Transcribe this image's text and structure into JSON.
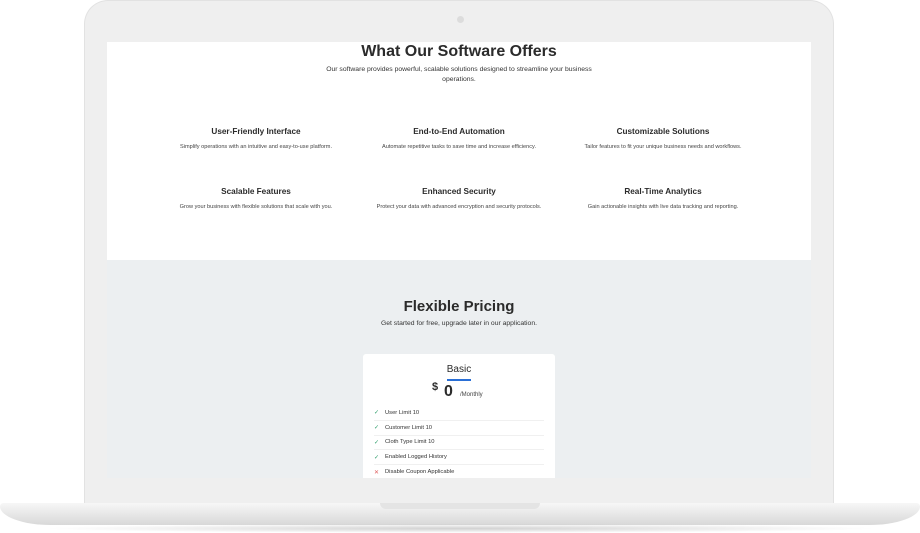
{
  "offers": {
    "title": "What Our Software Offers",
    "subtitle": "Our software provides powerful, scalable solutions designed to streamline your business operations.",
    "features": [
      {
        "title": "User-Friendly Interface",
        "desc": "Simplify operations with an intuitive and easy-to-use platform."
      },
      {
        "title": "End-to-End Automation",
        "desc": "Automate repetitive tasks to save time and increase efficiency."
      },
      {
        "title": "Customizable Solutions",
        "desc": "Tailor features to fit your unique business needs and workflows."
      },
      {
        "title": "Scalable Features",
        "desc": "Grow your business with flexible solutions that scale with you."
      },
      {
        "title": "Enhanced Security",
        "desc": "Protect your data with advanced encryption and security protocols."
      },
      {
        "title": "Real-Time Analytics",
        "desc": "Gain actionable insights with live data tracking and reporting."
      }
    ]
  },
  "pricing": {
    "title": "Flexible Pricing",
    "subtitle": "Get started for free, upgrade later in our application.",
    "plan": {
      "name": "Basic",
      "currency": "$",
      "price": "0",
      "period": "/Monthly",
      "items": [
        {
          "label": "User Limit 10",
          "included": true,
          "icon": "check-icon"
        },
        {
          "label": "Customer Limit 10",
          "included": true,
          "icon": "check-icon"
        },
        {
          "label": "Cloth Type Limit 10",
          "included": true,
          "icon": "check-icon"
        },
        {
          "label": "Enabled Logged History",
          "included": true,
          "icon": "check-icon"
        },
        {
          "label": "Disable Coupon Applicable",
          "included": false,
          "icon": "cross-icon"
        }
      ]
    }
  },
  "colors": {
    "accent": "#2a6fd6",
    "check": "#2e9e6a",
    "cross": "#e06060",
    "pricing_bg": "#eceff1"
  }
}
